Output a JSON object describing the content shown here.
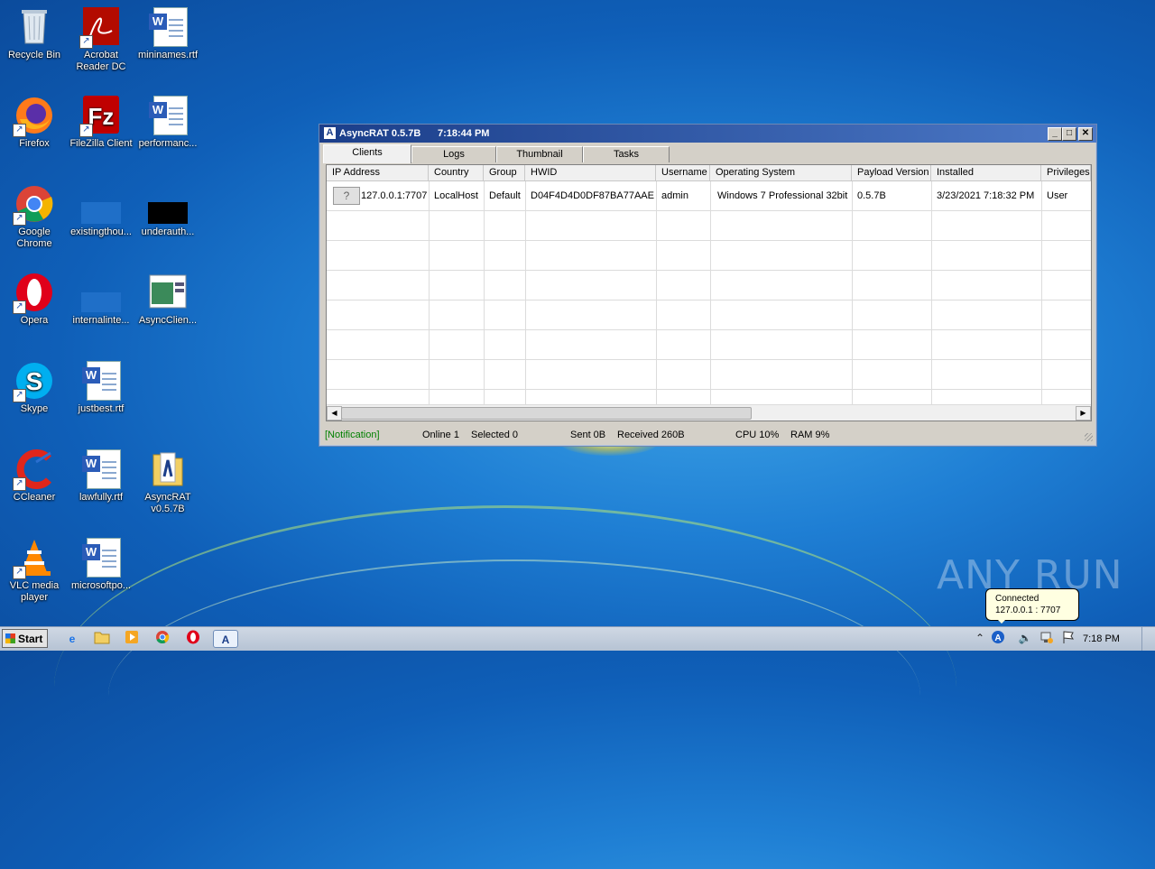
{
  "desktop": {
    "icons": [
      {
        "label": "Recycle Bin"
      },
      {
        "label": "Acrobat Reader DC"
      },
      {
        "label": "mininames.rtf"
      },
      {
        "label": "Firefox"
      },
      {
        "label": "FileZilla Client"
      },
      {
        "label": "performanc..."
      },
      {
        "label": "Google Chrome"
      },
      {
        "label": "existingthou..."
      },
      {
        "label": "underauth..."
      },
      {
        "label": "Opera"
      },
      {
        "label": "internalinte..."
      },
      {
        "label": "AsyncClien..."
      },
      {
        "label": "Skype"
      },
      {
        "label": "justbest.rtf"
      },
      {
        "label": "CCleaner"
      },
      {
        "label": "lawfully.rtf"
      },
      {
        "label": "AsyncRAT v0.5.7B"
      },
      {
        "label": "VLC media player"
      },
      {
        "label": "microsoftpo..."
      }
    ]
  },
  "window": {
    "title": "AsyncRAT 0.5.7B",
    "time": "7:18:44 PM",
    "tabs": [
      "Clients",
      "Logs",
      "Thumbnail",
      "Tasks"
    ],
    "active_tab": "Clients",
    "columns": [
      "IP Address",
      "Country",
      "Group",
      "HWID",
      "Username",
      "Operating System",
      "Payload Version",
      "Installed",
      "Privileges"
    ],
    "rows": [
      {
        "flag": "?",
        "ip": "127.0.0.1:7707",
        "country": "LocalHost",
        "group": "Default",
        "hwid": "D04F4D4D0DF87BA77AAE",
        "username": "admin",
        "os": "Windows 7 Professional  32bit",
        "payload": "0.5.7B",
        "installed": "3/23/2021 7:18:32 PM",
        "privileges": "User"
      }
    ],
    "status": {
      "notification": "[Notification]",
      "online": "Online 1",
      "selected": "Selected 0",
      "sent": "Sent 0B",
      "received": "Received 260B",
      "cpu": "CPU 10%",
      "ram": "RAM 9%"
    }
  },
  "balloon": {
    "line1": "Connected",
    "line2": "127.0.0.1 : 7707"
  },
  "taskbar": {
    "start": "Start",
    "clock": "7:18 PM"
  },
  "watermark": "ANY RUN",
  "colors": {
    "titlebar": "#1b3e8a",
    "notification": "#008000",
    "desktop": "#1f7fd4"
  }
}
